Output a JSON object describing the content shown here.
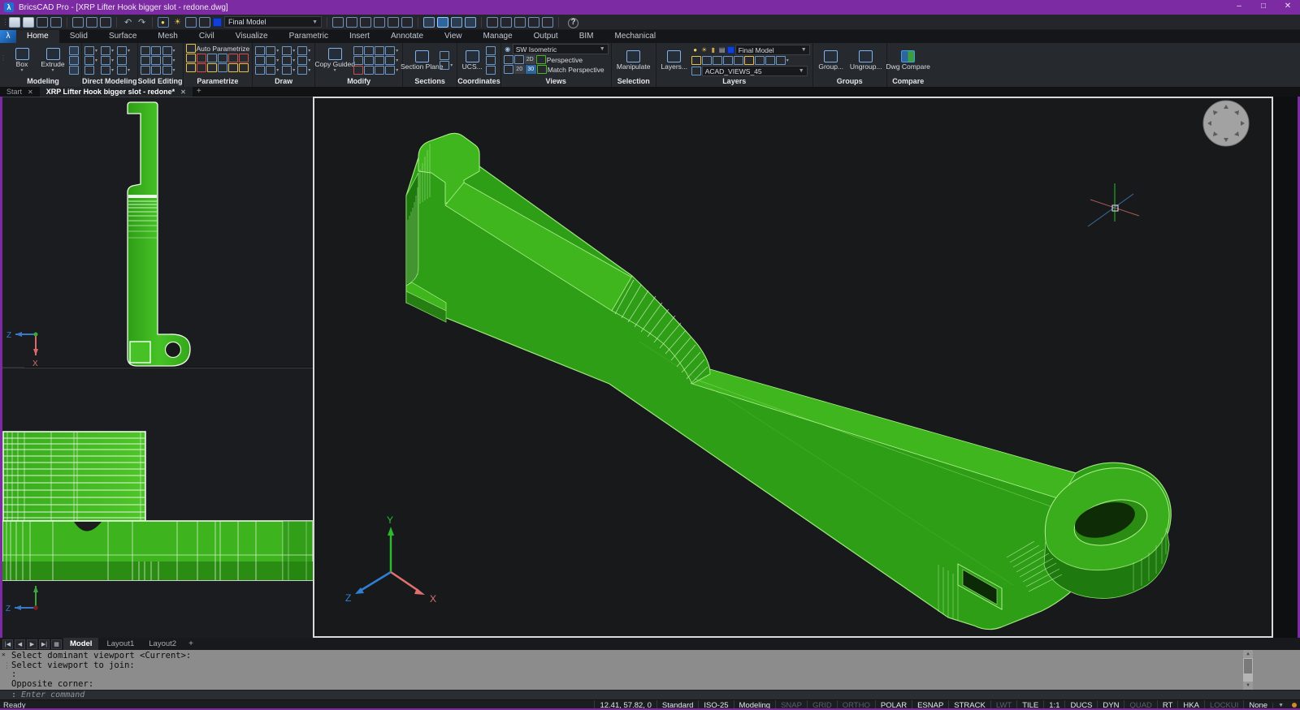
{
  "window": {
    "title": "BricsCAD Pro - [XRP Lifter Hook bigger slot - redone.dwg]"
  },
  "qat": {
    "profile_value": "Final Model"
  },
  "ribbon": {
    "tabs": [
      "Home",
      "Solid",
      "Surface",
      "Mesh",
      "Civil",
      "Visualize",
      "Parametric",
      "Insert",
      "Annotate",
      "View",
      "Manage",
      "Output",
      "BIM",
      "Mechanical"
    ],
    "panels": {
      "modeling": {
        "label": "Modeling",
        "box": "Box",
        "extrude": "Extrude"
      },
      "direct_modeling": {
        "label": "Direct Modeling"
      },
      "solid_editing": {
        "label": "Solid Editing"
      },
      "parametrize": {
        "label": "Parametrize",
        "auto_parametrize": "Auto Parametrize"
      },
      "draw": {
        "label": "Draw"
      },
      "modify": {
        "label": "Modify",
        "copy_guided": "Copy Guided"
      },
      "sections": {
        "label": "Sections",
        "section_plane": "Section Plane"
      },
      "coordinates": {
        "label": "Coordinates",
        "ucs": "UCS..."
      },
      "views": {
        "label": "Views",
        "view_value": "SW Isometric",
        "perspective": "Perspective",
        "match_perspective": "Match Perspective"
      },
      "selection": {
        "label": "Selection",
        "manipulate": "Manipulate"
      },
      "layers": {
        "label": "Layers",
        "layers_btn": "Layers...",
        "layer_value": "Final Model",
        "layer_state_value": "ACAD_VIEWS_45"
      },
      "groups": {
        "label": "Groups",
        "group": "Group...",
        "ungroup": "Ungroup..."
      },
      "compare": {
        "label": "Compare",
        "dwg_compare": "Dwg Compare"
      }
    }
  },
  "doc_tabs": {
    "items": [
      {
        "label": "Start"
      },
      {
        "label": "XRP Lifter Hook bigger slot - redone*"
      }
    ]
  },
  "layout_tabs": {
    "items": [
      "Model",
      "Layout1",
      "Layout2"
    ]
  },
  "command": {
    "history": [
      "Select dominant viewport <Current>:",
      "Select viewport to join:",
      ":",
      "Opposite corner:"
    ],
    "prompt": ":",
    "hint": "Enter command"
  },
  "statusbar": {
    "ready": "Ready",
    "coords": "12.41, 57.82, 0",
    "fields": [
      {
        "label": "Standard",
        "on": true
      },
      {
        "label": "ISO-25",
        "on": true
      },
      {
        "label": "Modeling",
        "on": true
      },
      {
        "label": "SNAP",
        "on": false
      },
      {
        "label": "GRID",
        "on": false
      },
      {
        "label": "ORTHO",
        "on": false
      },
      {
        "label": "POLAR",
        "on": true
      },
      {
        "label": "ESNAP",
        "on": true
      },
      {
        "label": "STRACK",
        "on": true
      },
      {
        "label": "LWT",
        "on": false
      },
      {
        "label": "TILE",
        "on": true
      },
      {
        "label": "1:1",
        "on": true
      },
      {
        "label": "DUCS",
        "on": true
      },
      {
        "label": "DYN",
        "on": true
      },
      {
        "label": "QUAD",
        "on": false
      },
      {
        "label": "RT",
        "on": true
      },
      {
        "label": "HKA",
        "on": true
      },
      {
        "label": "LOCKUI",
        "on": false
      },
      {
        "label": "None",
        "on": true
      }
    ]
  },
  "colors": {
    "title_purple": "#7c2ba3",
    "model_green_top": "#3fb61e",
    "model_green_front": "#2f9e17",
    "model_green_dark": "#1e7a0f",
    "edge_green": "#aef08d",
    "viewport_bg": "#17191b"
  }
}
